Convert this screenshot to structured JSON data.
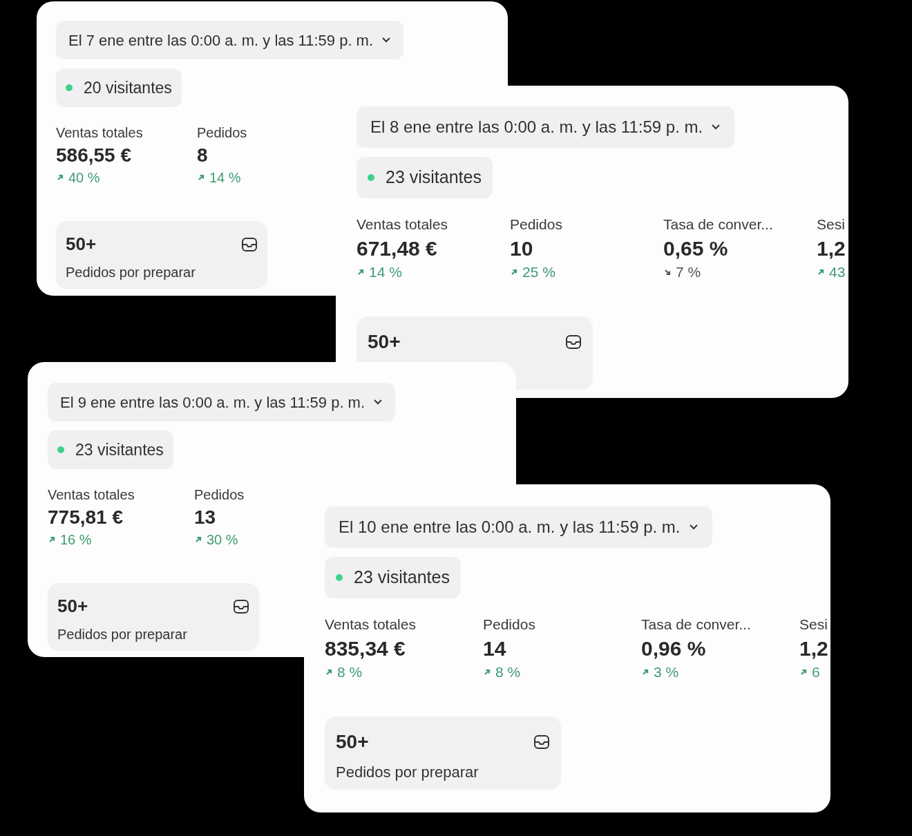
{
  "cards": [
    {
      "date": "El 7 ene entre las 0:00 a. m. y las 11:59 p. m.",
      "visitors": "20 visitantes",
      "metrics": [
        {
          "label": "Ventas totales",
          "value": "586,55 €",
          "change": "40 %",
          "rising": true
        },
        {
          "label": "Pedidos",
          "value": "8",
          "change": "14 %",
          "rising": true
        }
      ],
      "tile": {
        "value": "50+",
        "label": "Pedidos por preparar"
      }
    },
    {
      "date": "El 8 ene entre las 0:00 a. m. y las 11:59 p. m.",
      "visitors": "23 visitantes",
      "metrics": [
        {
          "label": "Ventas totales",
          "value": "671,48 €",
          "change": "14 %",
          "rising": true
        },
        {
          "label": "Pedidos",
          "value": "10",
          "change": "25 %",
          "rising": true
        },
        {
          "label": "Tasa de conver...",
          "value": "0,65 %",
          "change": "7 %",
          "rising": false
        },
        {
          "label": "Sesi",
          "value": "1,2",
          "change": "43",
          "rising": true
        }
      ],
      "tile": {
        "value": "50+"
      }
    },
    {
      "date": "El 9 ene entre las 0:00 a. m. y las 11:59 p. m.",
      "visitors": "23 visitantes",
      "metrics": [
        {
          "label": "Ventas totales",
          "value": "775,81 €",
          "change": "16 %",
          "rising": true
        },
        {
          "label": "Pedidos",
          "value": "13",
          "change": "30 %",
          "rising": true
        }
      ],
      "tile": {
        "value": "50+",
        "label": "Pedidos por preparar"
      }
    },
    {
      "date": "El 10 ene entre las 0:00 a. m. y las 11:59 p. m.",
      "visitors": "23 visitantes",
      "metrics": [
        {
          "label": "Ventas totales",
          "value": "835,34 €",
          "change": "8 %",
          "rising": true
        },
        {
          "label": "Pedidos",
          "value": "14",
          "change": "8 %",
          "rising": true
        },
        {
          "label": "Tasa de conver...",
          "value": "0,96 %",
          "change": "3 %",
          "rising": true
        },
        {
          "label": "Sesi",
          "value": "1,2",
          "change": "6",
          "rising": true
        }
      ],
      "tile": {
        "value": "50+",
        "label": "Pedidos por preparar"
      }
    }
  ]
}
